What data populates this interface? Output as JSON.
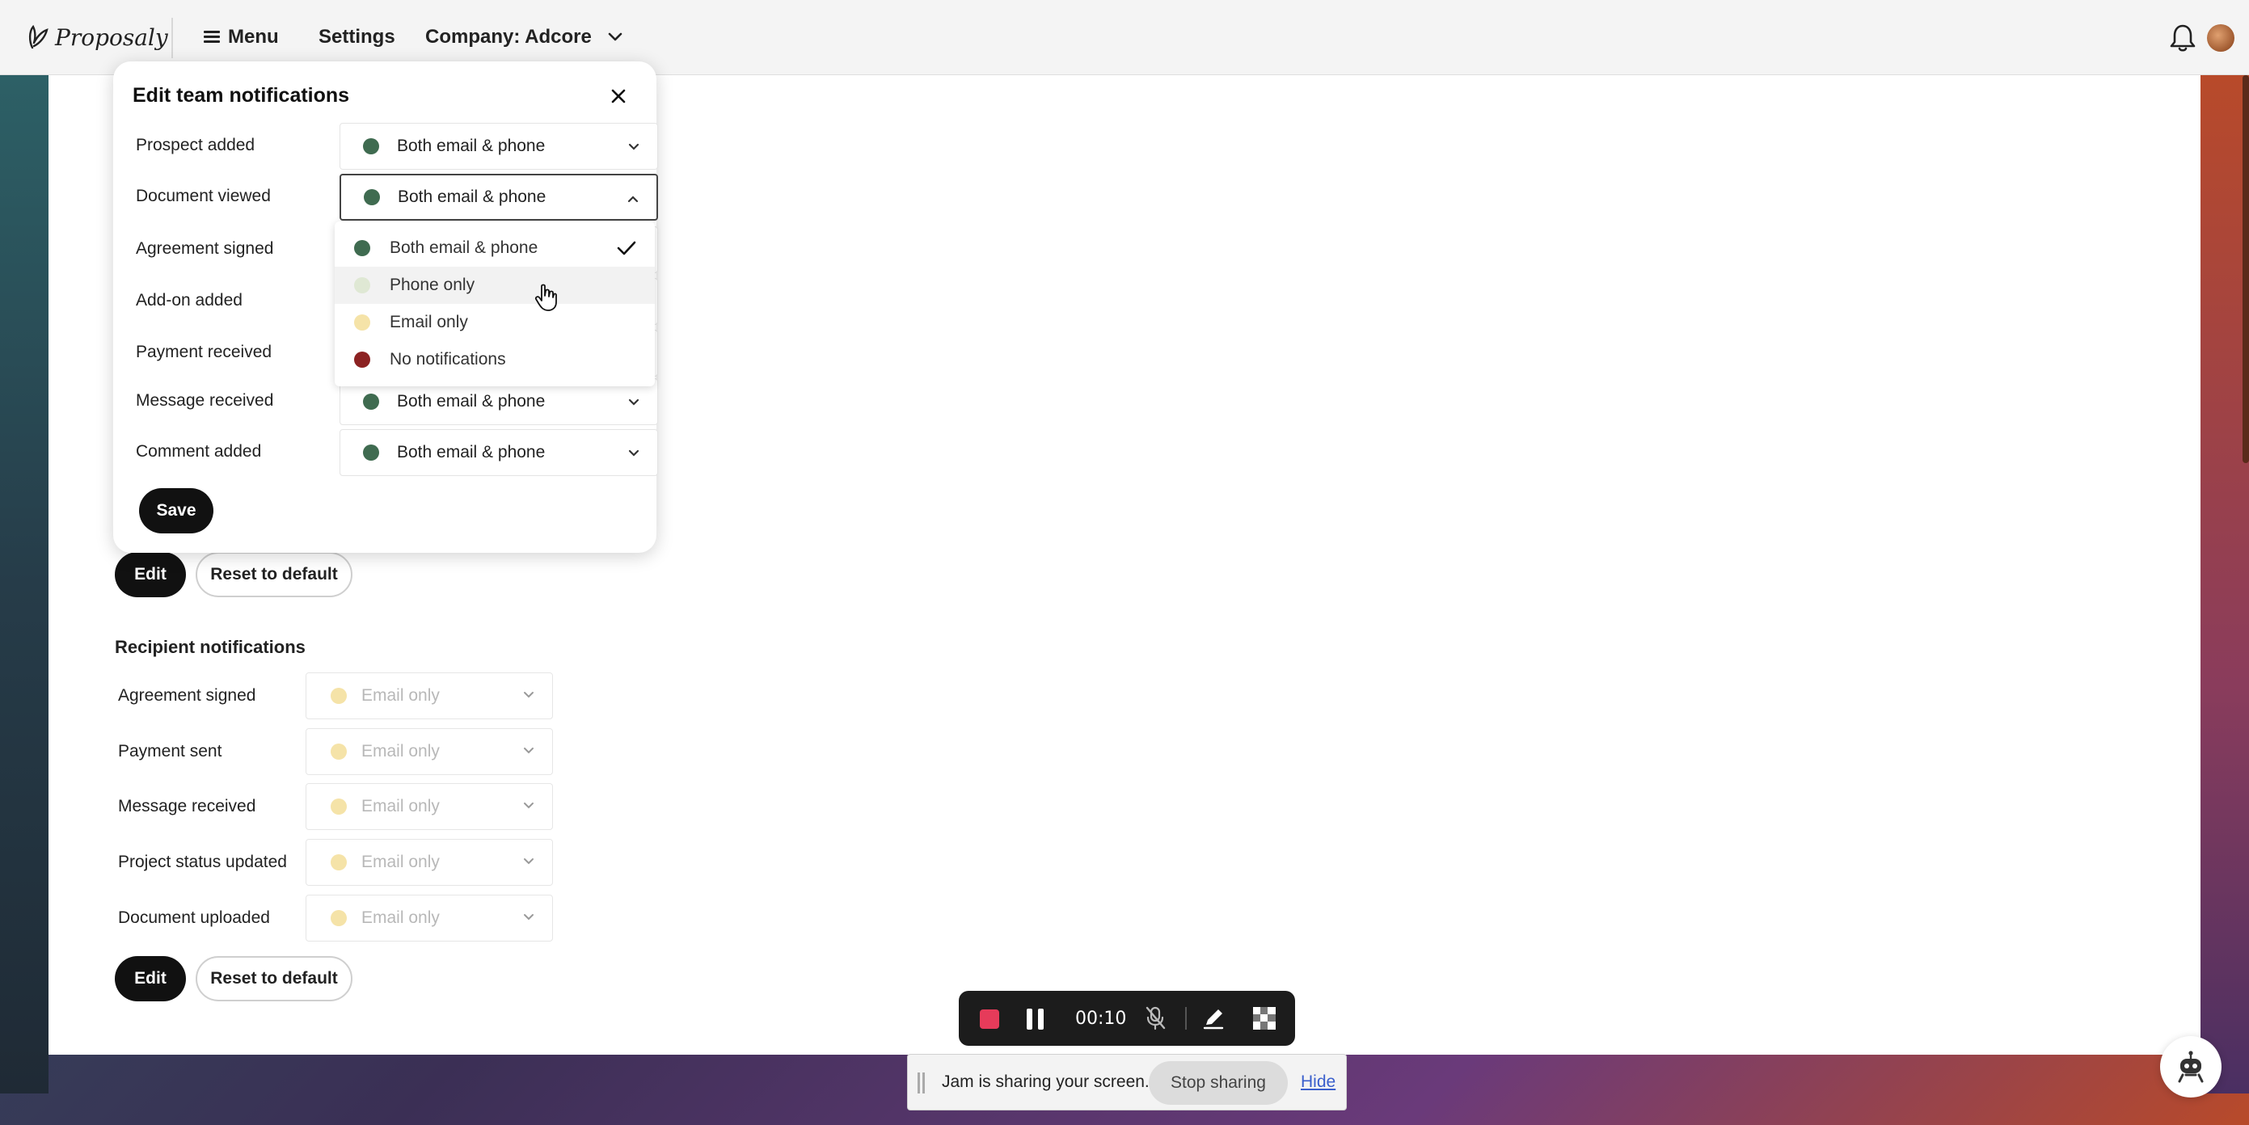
{
  "topbar": {
    "logo_text": "Proposaly",
    "menu_label": "Menu",
    "settings_label": "Settings",
    "company_label": "Company: Adcore"
  },
  "modal": {
    "title": "Edit team notifications",
    "rows": [
      {
        "label": "Prospect added",
        "value": "Both email & phone",
        "color": "#3f6b50"
      },
      {
        "label": "Document viewed",
        "value": "Both email & phone",
        "color": "#3f6b50"
      },
      {
        "label": "Agreement signed",
        "value": "",
        "color": ""
      },
      {
        "label": "Add-on added",
        "value": "",
        "color": ""
      },
      {
        "label": "Payment received",
        "value": "",
        "color": ""
      },
      {
        "label": "Message received",
        "value": "Both email & phone",
        "color": "#3f6b50"
      },
      {
        "label": "Comment added",
        "value": "Both email & phone",
        "color": "#3f6b50"
      }
    ],
    "save_label": "Save"
  },
  "dropdown": {
    "options": [
      {
        "label": "Both email & phone",
        "color": "#3f6b50",
        "selected": true
      },
      {
        "label": "Phone only",
        "color": "#dfe8d4",
        "selected": false
      },
      {
        "label": "Email only",
        "color": "#f5e3a8",
        "selected": false
      },
      {
        "label": "No notifications",
        "color": "#8c2222",
        "selected": false
      }
    ]
  },
  "team_actions": {
    "edit_label": "Edit",
    "reset_label": "Reset to default"
  },
  "recipient": {
    "title": "Recipient notifications",
    "rows": [
      {
        "label": "Agreement signed",
        "value": "Email only",
        "color": "#f5e3a8"
      },
      {
        "label": "Payment sent",
        "value": "Email only",
        "color": "#f5e3a8"
      },
      {
        "label": "Message received",
        "value": "Email only",
        "color": "#f5e3a8"
      },
      {
        "label": "Project status updated",
        "value": "Email only",
        "color": "#f5e3a8"
      },
      {
        "label": "Document uploaded",
        "value": "Email only",
        "color": "#f5e3a8"
      }
    ],
    "edit_label": "Edit",
    "reset_label": "Reset to default"
  },
  "recorder": {
    "time": "00:10"
  },
  "share_bar": {
    "text": "Jam is sharing your screen.",
    "stop_label": "Stop sharing",
    "hide_label": "Hide"
  }
}
